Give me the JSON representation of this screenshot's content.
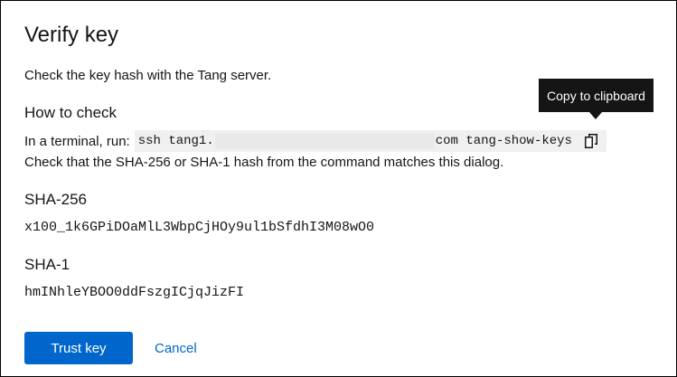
{
  "dialog": {
    "title": "Verify key",
    "description": "Check the key hash with the Tang server."
  },
  "how_to_check": {
    "heading": "How to check",
    "prefix": "In a terminal, run:",
    "command_start": "ssh tang1.",
    "command_end": "com tang-show-keys",
    "check_line": "Check that the SHA-256 or SHA-1 hash from the command matches this dialog."
  },
  "tooltip": {
    "text": "Copy to clipboard"
  },
  "sha256": {
    "heading": "SHA-256",
    "value": "x100_1k6GPiDOaMlL3WbpCjHOy9ul1bSfdhI3M08wO0"
  },
  "sha1": {
    "heading": "SHA-1",
    "value": "hmINhleYBOO0ddFszgICjqJizFI"
  },
  "actions": {
    "primary_label": "Trust key",
    "cancel_label": "Cancel"
  },
  "colors": {
    "primary": "#0066cc",
    "text": "#151515",
    "tooltip_bg": "#151515",
    "code_bg": "#f0f0f0"
  },
  "icons": {
    "copy": "copy-icon"
  }
}
